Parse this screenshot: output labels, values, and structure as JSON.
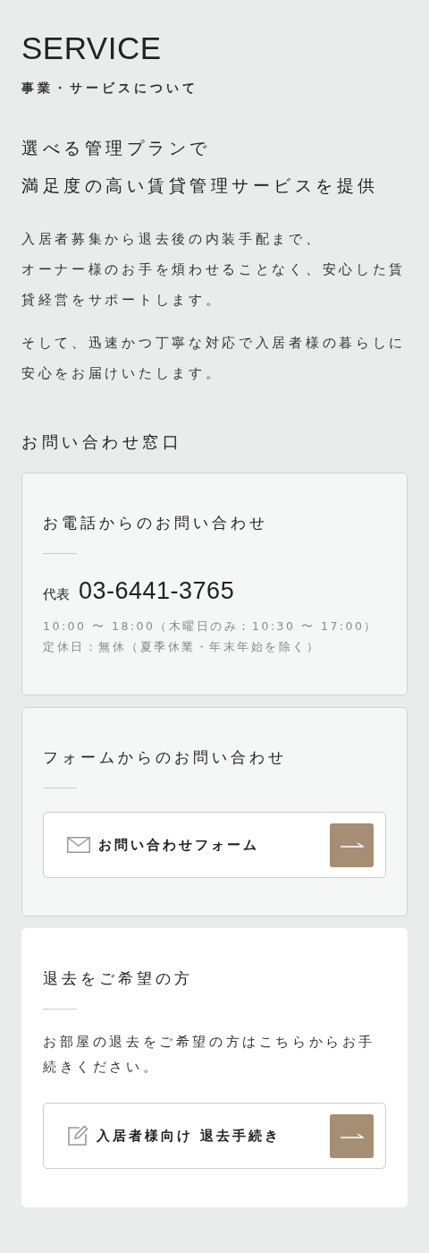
{
  "heading": {
    "title": "SERVICE",
    "subtitle": "事業・サービスについて"
  },
  "lead": {
    "headline_lines": [
      "選べる管理プランで",
      "満足度の高い賃貸管理サービスを提供"
    ],
    "paragraphs": [
      [
        "入居者募集から退去後の内装手配まで、",
        "オーナー様のお手を煩わせることなく、安心した賃貸経営をサポートします。"
      ],
      [
        "そして、迅速かつ丁寧な対応で入居者様の暮らしに安心をお届けいたします。"
      ]
    ]
  },
  "contact": {
    "title": "お問い合わせ窓口",
    "cards": [
      {
        "kind": "phone",
        "title": "お電話からのお問い合わせ",
        "phone_label": "代表",
        "phone": "03-6441-3765",
        "notes": [
          "10:00 〜 18:00（木曜日のみ：10:30 〜 17:00）",
          "定休日：無休（夏季休業・年末年始を除く）"
        ]
      },
      {
        "kind": "form",
        "title": "フォームからのお問い合わせ",
        "link": {
          "label": "お問い合わせフォーム"
        }
      },
      {
        "kind": "moveout",
        "title": "退去をご希望の方",
        "text": "お部屋の退去をご希望の方はこちらからお手続きください。",
        "link": {
          "label": "入居者様向け 退去手続き"
        }
      }
    ]
  }
}
